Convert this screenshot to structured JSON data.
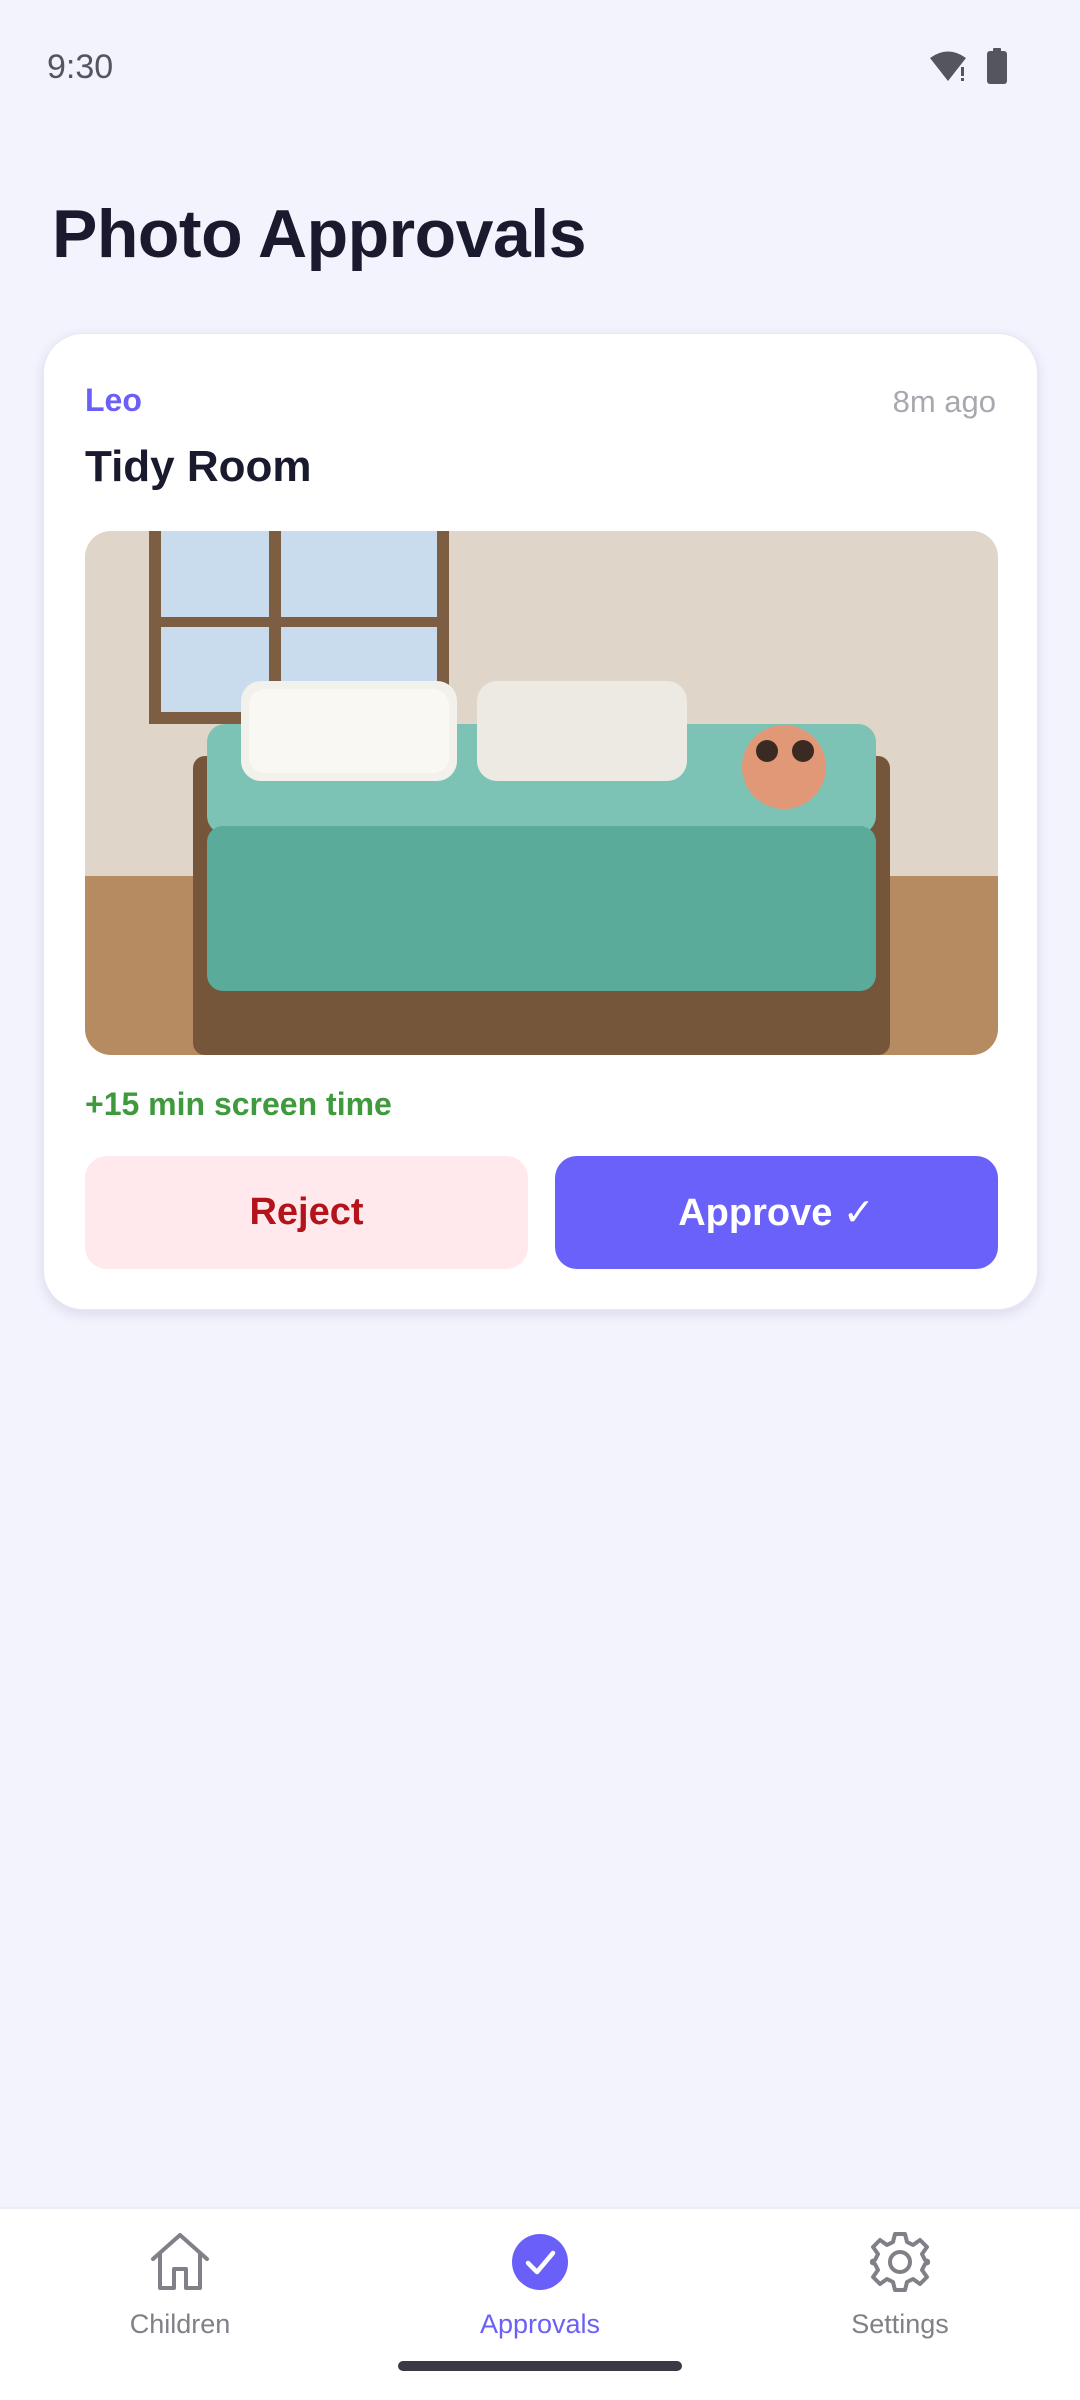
{
  "status_bar": {
    "time": "9:30",
    "icons": [
      "wifi-alert-icon",
      "battery-icon"
    ]
  },
  "page": {
    "title": "Photo Approvals"
  },
  "approval_card": {
    "child_name": "Leo",
    "time_ago": "8m ago",
    "task_title": "Tidy Room",
    "reward": "+15 min screen time",
    "reject_label": "Reject",
    "approve_label": "Approve ✓"
  },
  "bottom_nav": {
    "items": [
      {
        "label": "Children",
        "icon": "home-icon",
        "active": false
      },
      {
        "label": "Approvals",
        "icon": "check-circle-icon",
        "active": true
      },
      {
        "label": "Settings",
        "icon": "gear-icon",
        "active": false
      }
    ]
  },
  "colors": {
    "accent": "#6a5ff8",
    "background": "#f3f3fe",
    "reward_green": "#3e9a3c",
    "reject_red": "#b3141c",
    "reject_bg": "#ffe9ec"
  }
}
